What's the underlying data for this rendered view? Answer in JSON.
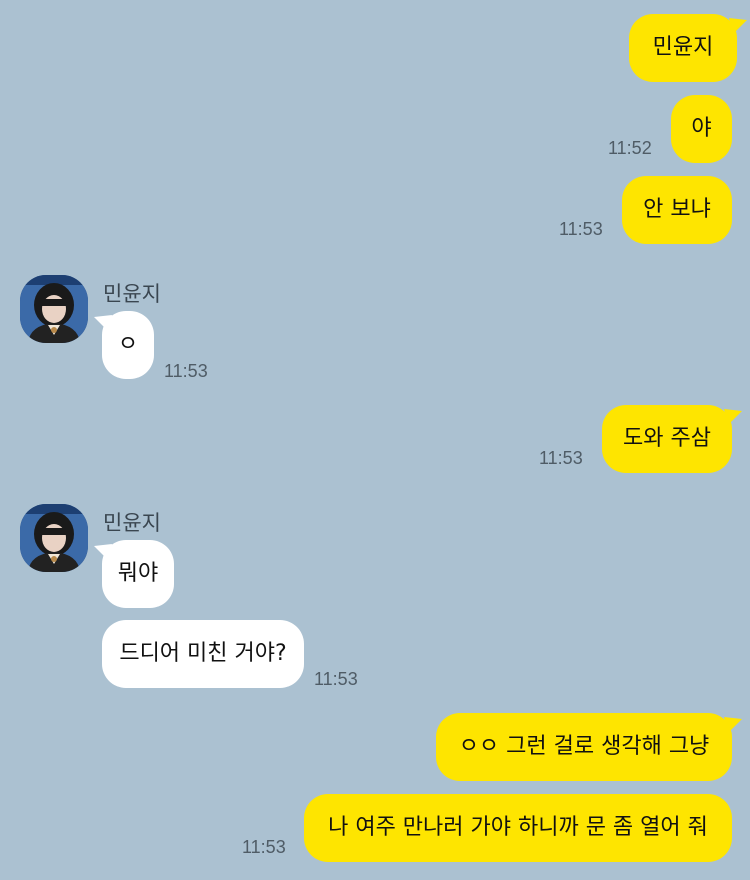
{
  "chat": {
    "sender_name": "민윤지",
    "messages": [
      {
        "text": "민윤지",
        "time": ""
      },
      {
        "text": "야",
        "time": "11:52"
      },
      {
        "text": "안 보냐",
        "time": "11:53"
      },
      {
        "text": "ㅇ",
        "time": "11:53"
      },
      {
        "text": "도와 주삼",
        "time": "11:53"
      },
      {
        "text": "뭐야",
        "time": ""
      },
      {
        "text": "드디어 미친 거야?",
        "time": "11:53"
      },
      {
        "text": "ㅇㅇ 그런 걸로 생각해 그냥",
        "time": ""
      },
      {
        "text": "나 여주 만나러 가야 하니까 문 좀 열어 줘",
        "time": "11:53"
      }
    ]
  },
  "colors": {
    "background": "#abc1d1",
    "my_bubble": "#fee500",
    "their_bubble": "#ffffff"
  }
}
